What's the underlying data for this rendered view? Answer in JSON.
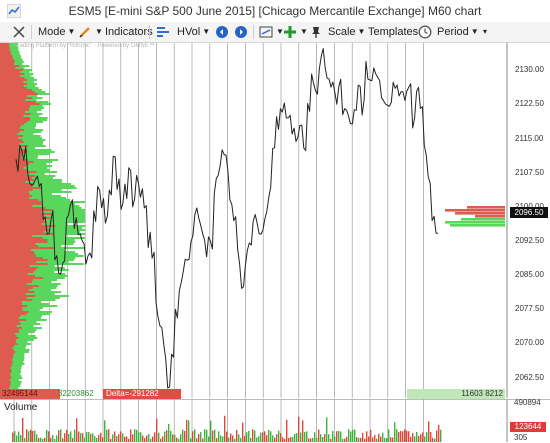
{
  "window": {
    "title": "ESM5 [E-mini S&P 500 June 2015] [Chicago Mercantile Exchange] M60 chart"
  },
  "toolbar": {
    "mode_label": "Mode",
    "indicators_label": "Indicators",
    "hvol_label": "HVol",
    "scale_label": "Scale",
    "templates_label": "Templates",
    "period_label": "Period"
  },
  "watermark": {
    "text": "Trading Platform by \"Rithmic\" · Powered by OMNE™"
  },
  "price_axis": {
    "ticks": [
      "2130.00",
      "2122.50",
      "2115.00",
      "2107.50",
      "2100.00",
      "2092.50",
      "2085.00",
      "2077.50",
      "2070.00",
      "2062.50"
    ],
    "last_price": "2096.50"
  },
  "profile_stats": {
    "left_total": "32495144",
    "right_total": "32203862",
    "delta": "Delta=-291282",
    "bottom_right": "11603 8212"
  },
  "volume": {
    "label": "Volume",
    "ticks": [
      "490894",
      "305"
    ],
    "last_value": "123644"
  },
  "colors": {
    "profile_sell": "#de5b4f",
    "profile_buy": "#59d65c",
    "price_line": "#222222",
    "grid": "#9a9a9a",
    "last_price_bg": "#111111",
    "volume_up": "#3db33d",
    "volume_down": "#d94a3c"
  },
  "chart_data": {
    "type": "line",
    "title": "ESM5 M60",
    "ylim": [
      2058,
      2136
    ],
    "y_ticks": [
      2130.0,
      2122.5,
      2115.0,
      2107.5,
      2100.0,
      2092.5,
      2085.0,
      2077.5,
      2070.0,
      2062.5
    ],
    "series": [
      {
        "name": "price",
        "values": [
          2110,
          2113,
          2111,
          2107,
          2104,
          2108,
          2106,
          2099,
          2094,
          2097,
          2090,
          2087,
          2089,
          2099,
          2102,
          2096,
          2094,
          2091,
          2088,
          2090,
          2098,
          2104,
          2100,
          2098,
          2104,
          2110,
          2105,
          2101,
          2104,
          2109,
          2102,
          2106,
          2104,
          2100,
          2093,
          2089,
          2078,
          2072,
          2068,
          2061,
          2066,
          2076,
          2082,
          2087,
          2088,
          2093,
          2100,
          2098,
          2094,
          2091,
          2092,
          2104,
          2108,
          2112,
          2110,
          2103,
          2096,
          2090,
          2084,
          2088,
          2094,
          2098,
          2096,
          2095,
          2099,
          2104,
          2112,
          2118,
          2120,
          2122,
          2121,
          2116,
          2114,
          2116,
          2114,
          2122,
          2128,
          2126,
          2131,
          2133,
          2129,
          2125,
          2124,
          2127,
          2120,
          2121,
          2117,
          2120,
          2126,
          2122,
          2130,
          2128,
          2131,
          2129,
          2125,
          2124,
          2123,
          2128,
          2126,
          2127,
          2125,
          2127,
          2119,
          2124,
          2122,
          2113,
          2105,
          2098,
          2096
        ]
      }
    ]
  }
}
